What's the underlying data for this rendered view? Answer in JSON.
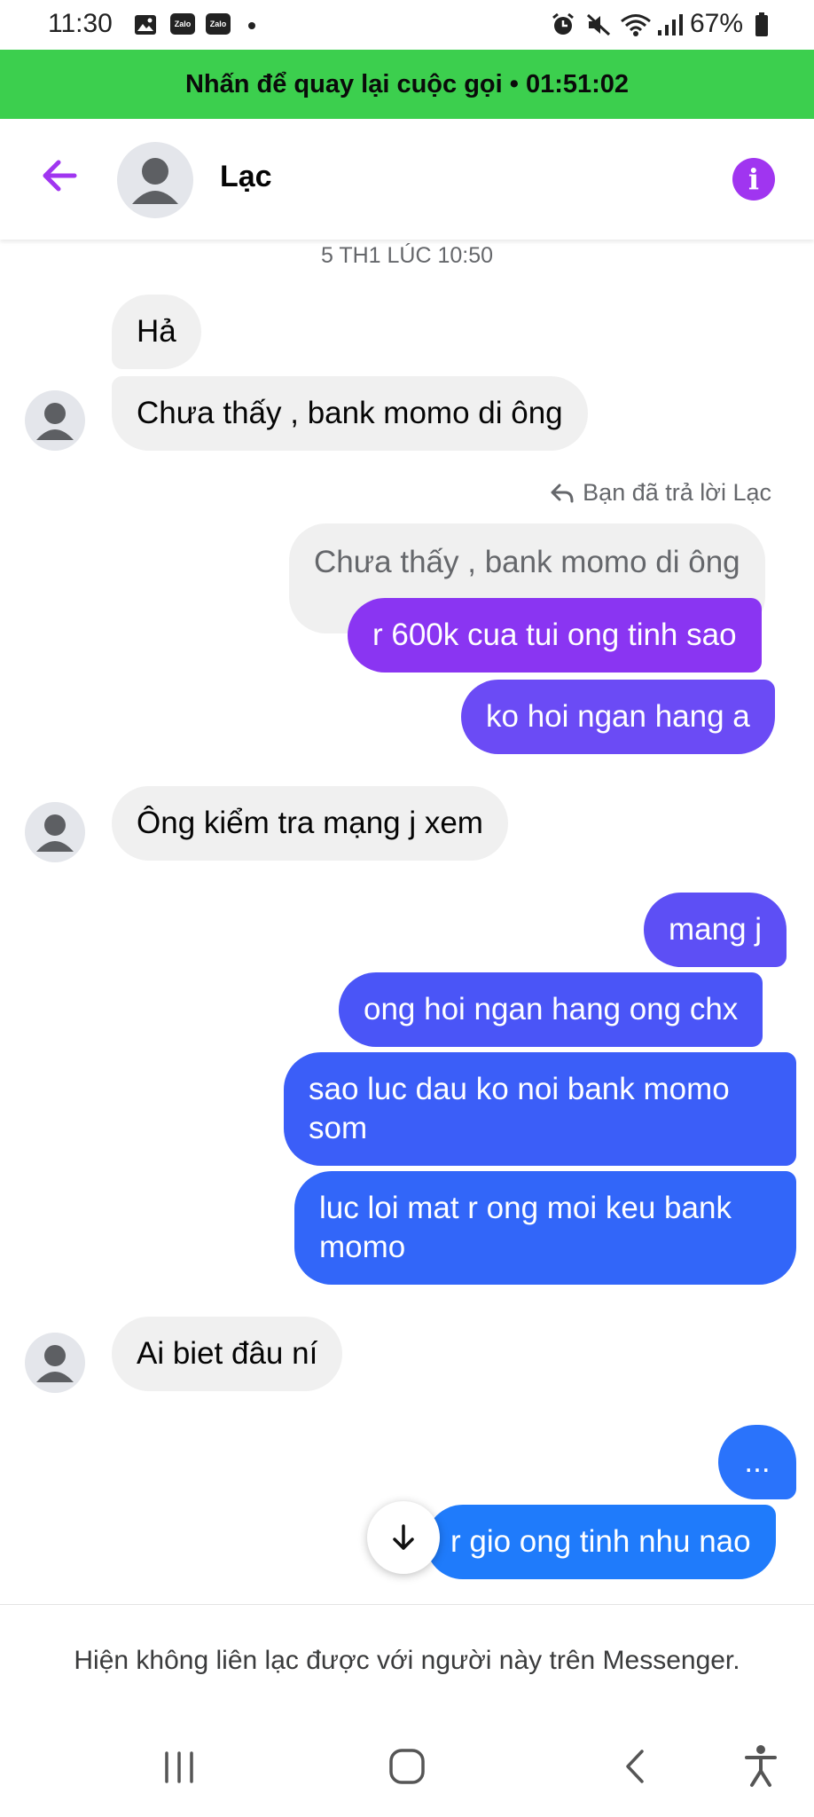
{
  "status_bar": {
    "time": "11:30",
    "apps": [
      "Zalo",
      "Zalo"
    ],
    "battery": "67%"
  },
  "call_banner": {
    "text": "Nhấn để quay lại cuộc gọi • 01:51:02"
  },
  "header": {
    "contact_name": "Lạc"
  },
  "conversation": {
    "timestamp": "5 TH1 LÚC 10:50",
    "reply_label": "Bạn đã trả lời Lạc",
    "messages": {
      "m1": "Hả",
      "m2": "Chưa thấy , bank momo di ông",
      "quote": "Chưa thấy , bank momo di ông",
      "m3": "r 600k cua tui ong tinh sao",
      "m4": "ko hoi ngan hang a",
      "m5": "Ông kiểm tra mạng j xem",
      "m6": "mang j",
      "m7": "ong hoi ngan hang ong chx",
      "m8": "sao luc dau ko noi bank momo som",
      "m9": "luc loi mat r ong moi keu bank momo",
      "m10": "Ai biet đâu ní",
      "m11": "...",
      "m12": "r gio ong tinh nhu nao"
    }
  },
  "footer": {
    "unavailable_text": "Hiện không liên lạc được với người này trên Messenger."
  },
  "colors": {
    "banner": "#3ccf4e",
    "accent": "#a035f0",
    "incoming": "#f0f0f0",
    "purple_bubble": "#8a35f2",
    "blue_bubble": "#2f6bff"
  }
}
